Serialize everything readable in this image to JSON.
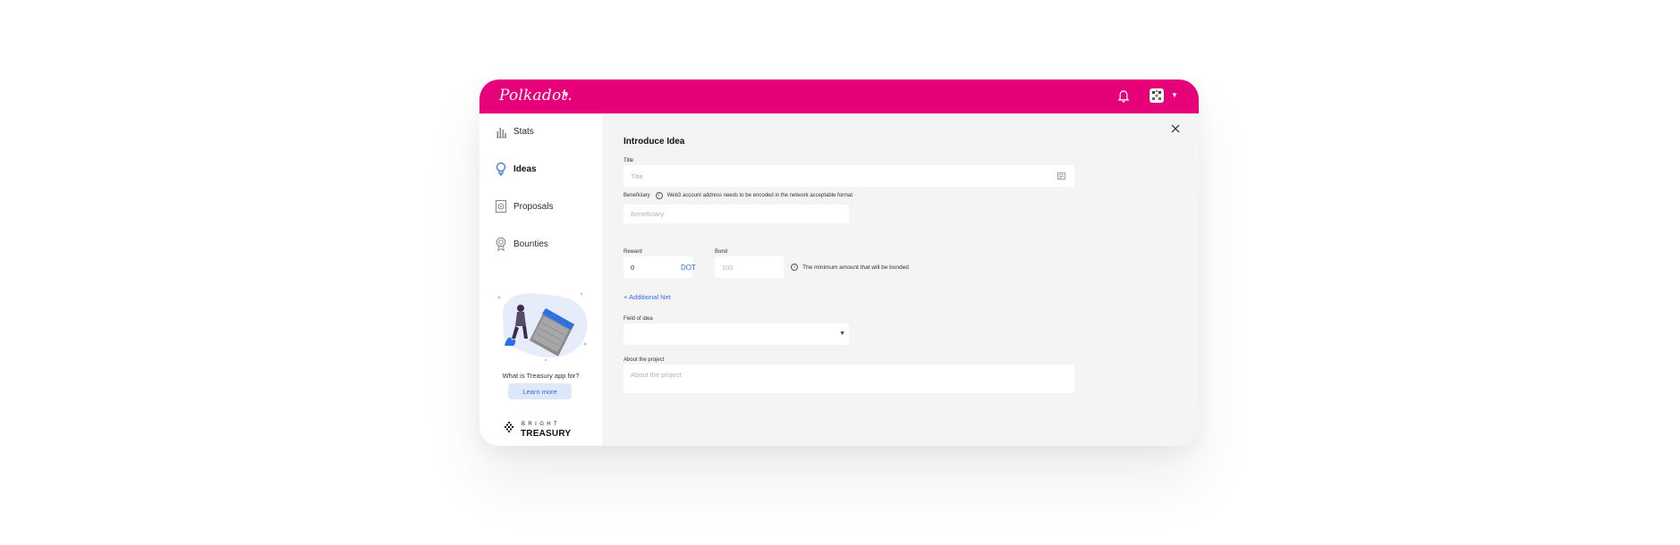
{
  "header": {
    "logo": "Polkadot.",
    "brand_color": "#e6007a",
    "icons": [
      "caret-down-icon",
      "bell-icon",
      "avatar-icon"
    ]
  },
  "sidebar": {
    "items": [
      {
        "label": "Stats",
        "icon": "stats-icon"
      },
      {
        "label": "Ideas",
        "icon": "lightbulb-icon",
        "active": true
      },
      {
        "label": "Proposals",
        "icon": "proposal-icon"
      },
      {
        "label": "Bounties",
        "icon": "bounty-icon"
      }
    ],
    "treasury_question": "What is Treasury app for?",
    "learn_more": "Learn more",
    "bright": "BRIGHT",
    "treasury": "TREASURY"
  },
  "form": {
    "title": "Introduce Idea",
    "title_label": "Title",
    "title_placeholder": "Title",
    "beneficiary_label": "Beneficiary",
    "beneficiary_info": "Web3 account address needs to be encoded in the network acceptable format",
    "beneficiary_placeholder": "Beneficiary",
    "reward_label": "Reward",
    "reward_value": "0",
    "reward_unit": "DOT",
    "bond_label": "Bond",
    "bond_value": "100",
    "bond_info": "The minimum amount that will be bonded",
    "additional_net": "+ Additional Net",
    "field_label": "Field of idea",
    "field_value": "",
    "about_label": "About the project",
    "about_placeholder": "About the project"
  }
}
